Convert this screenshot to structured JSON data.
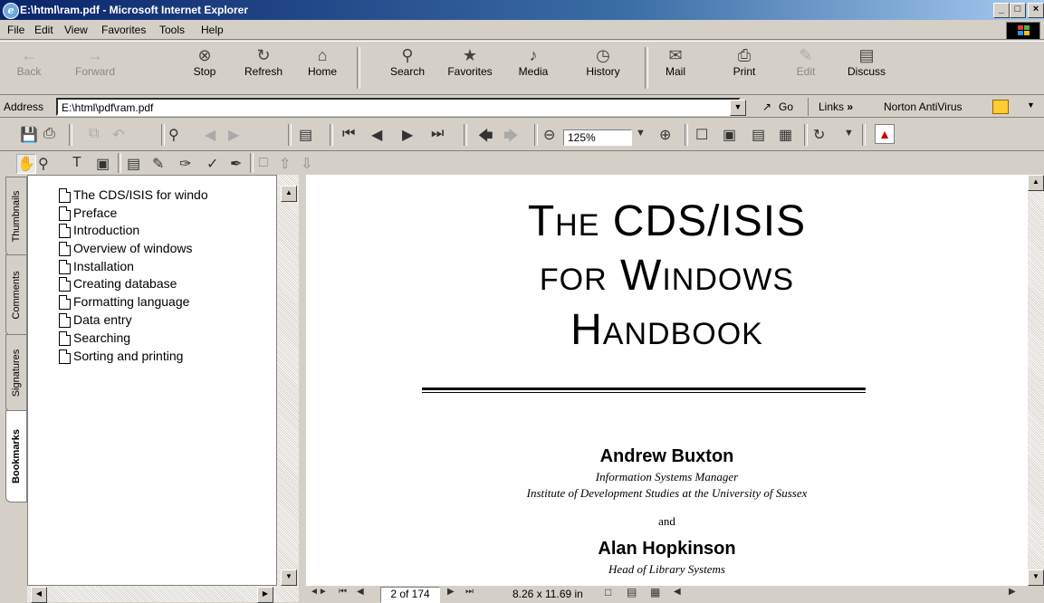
{
  "window": {
    "title": "E:\\html\\ram.pdf - Microsoft Internet Explorer",
    "minimize": "_",
    "maximize": "□",
    "close": "×"
  },
  "menu": [
    "File",
    "Edit",
    "View",
    "Favorites",
    "Tools",
    "Help"
  ],
  "toolbar": {
    "back": "Back",
    "forward": "Forward",
    "stop": "Stop",
    "refresh": "Refresh",
    "home": "Home",
    "search": "Search",
    "favorites": "Favorites",
    "media": "Media",
    "history": "History",
    "mail": "Mail",
    "print": "Print",
    "edit": "Edit",
    "discuss": "Discuss"
  },
  "address": {
    "label": "Address",
    "value": "E:\\html\\pdf\\ram.pdf",
    "go": "Go",
    "links": "Links",
    "links_chevron": "»",
    "norton": "Norton AntiVirus"
  },
  "acrobat": {
    "zoom": "125%"
  },
  "side_tabs": [
    "Thumbnails",
    "Comments",
    "Signatures",
    "Bookmarks"
  ],
  "bookmarks": [
    "The CDS/ISIS for windo",
    "Preface",
    "Introduction",
    "Overview of windows",
    "Installation",
    "Creating database",
    "Formatting language",
    "Data entry",
    "Searching",
    "Sorting and printing"
  ],
  "document": {
    "title_lines": [
      "The CDS/ISIS",
      "for Windows",
      "Handbook"
    ],
    "author1": "Andrew Buxton",
    "author1_role1": "Information Systems Manager",
    "author1_role2": "Institute of Development Studies at the University of Sussex",
    "and": "and",
    "author2": "Alan Hopkinson",
    "author2_role": "Head of Library Systems"
  },
  "status": {
    "page": "2 of 174",
    "size": "8.26 x 11.69 in"
  },
  "colors": {
    "titlebar_start": "#0a246a",
    "titlebar_end": "#a6caf0",
    "chrome": "#d4d0c8"
  }
}
